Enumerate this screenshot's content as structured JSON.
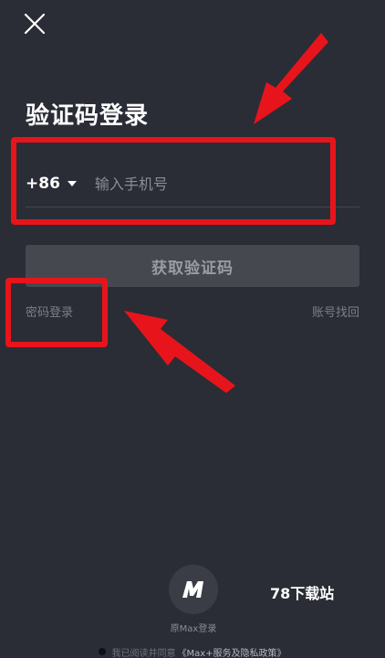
{
  "header": {
    "close_icon": "close-icon"
  },
  "title": "验证码登录",
  "phone": {
    "country_code": "+86",
    "placeholder": "输入手机号"
  },
  "get_code_button": "获取验证码",
  "links": {
    "password_login": "密码登录",
    "account_recovery": "账号找回"
  },
  "max_login": {
    "icon": "max-logo-icon",
    "label": "原Max登录"
  },
  "watermark": "78下载站",
  "agreement": {
    "prefix": "我已阅读并同意",
    "link": "《Max+服务及隐私政策》"
  },
  "colors": {
    "background": "#2a2d35",
    "button_disabled": "#45484f",
    "annotation_red": "#e8141c"
  }
}
